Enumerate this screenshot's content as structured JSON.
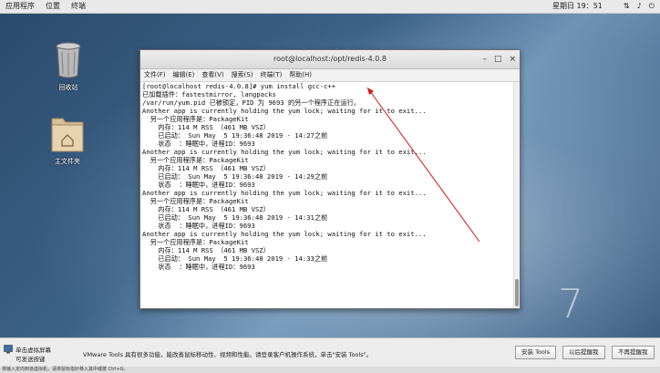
{
  "topbar": {
    "menu": [
      "应用程序",
      "位置",
      "终端"
    ],
    "clock": "星期日 19：51",
    "icons": [
      "network-icon",
      "volume-icon",
      "power-icon"
    ]
  },
  "desktop": {
    "trash_label": "回收站",
    "folder_label": "主文件夹",
    "watermark": "7"
  },
  "terminal": {
    "title": "root@localhost:/opt/redis-4.0.8",
    "controls": [
      "–",
      "□",
      "×"
    ],
    "menu": [
      "文件(F)",
      "编辑(E)",
      "查看(V)",
      "搜索(S)",
      "终端(T)",
      "帮助(H)"
    ],
    "lines": [
      "[root@localhost redis-4.0.8]# yum install gcc-c++",
      "已加载插件：fastestmirror, langpacks",
      "/var/run/yum.pid 已被锁定，PID 为 9693 的另一个程序正在运行。",
      "Another app is currently holding the yum lock; waiting for it to exit...",
      "  另一个应用程序是：PackageKit",
      "    内存：114 M RSS （461 MB VSZ）",
      "    已启动： Sun May  5 19:36:48 2019 - 14:27之前",
      "    状态  ：睡眠中，进程ID：9693",
      "Another app is currently holding the yum lock; waiting for it to exit...",
      "  另一个应用程序是：PackageKit",
      "    内存：114 M RSS （461 MB VSZ）",
      "    已启动： Sun May  5 19:36:48 2019 - 14:29之前",
      "    状态  ：睡眠中，进程ID：9693",
      "Another app is currently holding the yum lock; waiting for it to exit...",
      "  另一个应用程序是：PackageKit",
      "    内存：114 M RSS （461 MB VSZ）",
      "    已启动： Sun May  5 19:36:48 2019 - 14:31之前",
      "    状态  ：睡眠中，进程ID：9693",
      "Another app is currently holding the yum lock; waiting for it to exit...",
      "  另一个应用程序是：PackageKit",
      "    内存：114 M RSS （461 MB VSZ）",
      "    已启动： Sun May  5 19:36:48 2019 - 14:33之前",
      "    状态  ：睡眠中，进程ID：9693"
    ]
  },
  "vmware": {
    "tip_line1": "单击虚拟屏幕",
    "tip_line2": "可发送按键",
    "message": "VMware Tools 具有很多功能，能改善鼠标移动性、视频和性能。请登录客户机操作系统，单击\"安装 Tools\"。",
    "install_btn": "安装 Tools",
    "later_btn": "以后提醒我",
    "never_btn": "不再提醒我",
    "status": "将输入定向到该虚拟机，请将鼠标指针移入其中或按 Ctrl+G。"
  }
}
